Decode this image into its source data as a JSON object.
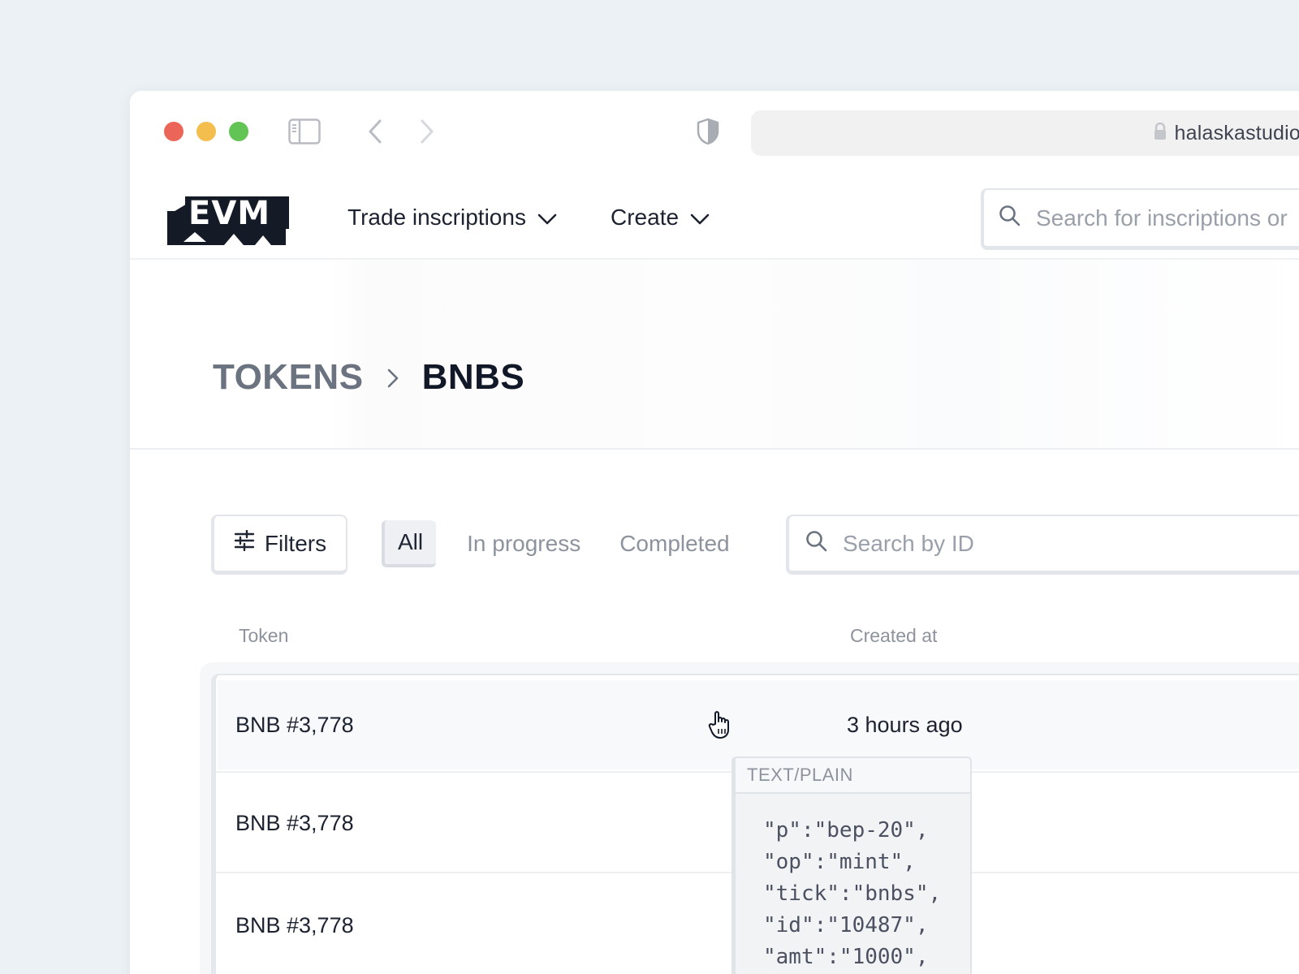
{
  "browser": {
    "url": "halaskastudio.com"
  },
  "header": {
    "logo_text": "EVM",
    "nav": [
      {
        "label": "Trade inscriptions"
      },
      {
        "label": "Create"
      }
    ],
    "search_placeholder": "Search for inscriptions or"
  },
  "breadcrumb": {
    "parent": "TOKENS",
    "current": "BNBS"
  },
  "filters": {
    "button_label": "Filters",
    "tabs": [
      {
        "label": "All",
        "active": true
      },
      {
        "label": "In progress",
        "active": false
      },
      {
        "label": "Completed",
        "active": false
      }
    ],
    "search_placeholder": "Search by ID"
  },
  "table": {
    "columns": [
      "Token",
      "Created at"
    ],
    "rows": [
      {
        "token": "BNB #3,778",
        "created_at": "3 hours ago"
      },
      {
        "token": "BNB #3,778",
        "created_at": ""
      },
      {
        "token": "BNB #3,778",
        "created_at": ""
      }
    ]
  },
  "tooltip": {
    "mime": "TEXT/PLAIN",
    "content": "\"p\":\"bep-20\",\n\"op\":\"mint\",\n\"tick\":\"bnbs\",\n\"id\":\"10487\",\n\"amt\":\"1000\","
  },
  "colors": {
    "background": "#ebf1f4",
    "traffic_red": "#ec6559",
    "traffic_yellow": "#f4be4f",
    "traffic_green": "#61c454",
    "text_primary": "#111827",
    "text_muted": "#8d939d"
  }
}
